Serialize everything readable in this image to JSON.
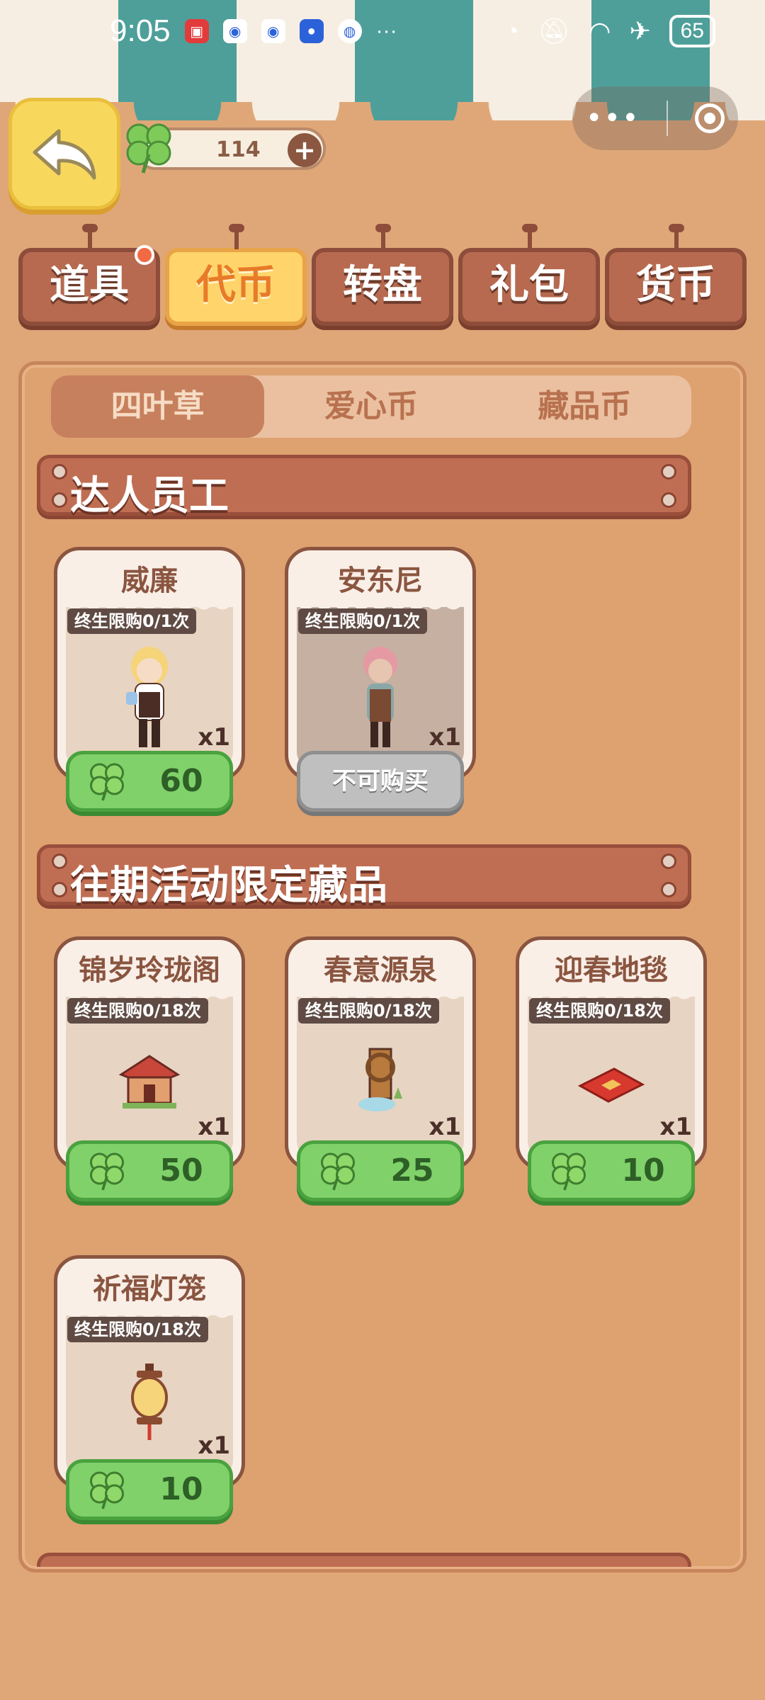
{
  "status_bar": {
    "time": "9:05",
    "more": "···",
    "battery": "65",
    "icons": [
      "huawei-store-icon",
      "app-icon",
      "app-icon",
      "bulb-icon",
      "browser-icon",
      "clock-icon",
      "bell-off-icon",
      "wifi-icon",
      "airplane-icon"
    ]
  },
  "header": {
    "back_icon": "back-arrow-icon",
    "currency_amount": "114",
    "plus_label": "+",
    "mini_program_more": "•••"
  },
  "category_tabs": [
    {
      "label": "道具",
      "active": false,
      "badge": true
    },
    {
      "label": "代币",
      "active": true,
      "badge": false
    },
    {
      "label": "转盘",
      "active": false,
      "badge": false
    },
    {
      "label": "礼包",
      "active": false,
      "badge": false
    },
    {
      "label": "货币",
      "active": false,
      "badge": false
    }
  ],
  "sub_tabs": [
    {
      "label": "四叶草",
      "active": true
    },
    {
      "label": "爱心币",
      "active": false
    },
    {
      "label": "藏品币",
      "active": false
    }
  ],
  "sections": [
    {
      "title": "达人员工",
      "items": [
        {
          "name": "威廉",
          "limit": "终生限购0/1次",
          "qty": "x1",
          "price": "60",
          "available": true
        },
        {
          "name": "安东尼",
          "limit": "终生限购0/1次",
          "qty": "x1",
          "price": "不可购买",
          "available": false
        }
      ]
    },
    {
      "title": "往期活动限定藏品",
      "items": [
        {
          "name": "锦岁玲珑阁",
          "limit": "终生限购0/18次",
          "qty": "x1",
          "price": "50",
          "available": true
        },
        {
          "name": "春意源泉",
          "limit": "终生限购0/18次",
          "qty": "x1",
          "price": "25",
          "available": true
        },
        {
          "name": "迎春地毯",
          "limit": "终生限购0/18次",
          "qty": "x1",
          "price": "10",
          "available": true
        },
        {
          "name": "祈福灯笼",
          "limit": "终生限购0/18次",
          "qty": "x1",
          "price": "10",
          "available": true
        }
      ]
    }
  ],
  "colors": {
    "background": "#dfa778",
    "awning_teal": "#4e9f9a",
    "tab_brown": "#b76a4f",
    "tab_active": "#ffd46a",
    "price_green": "#80d16a"
  }
}
